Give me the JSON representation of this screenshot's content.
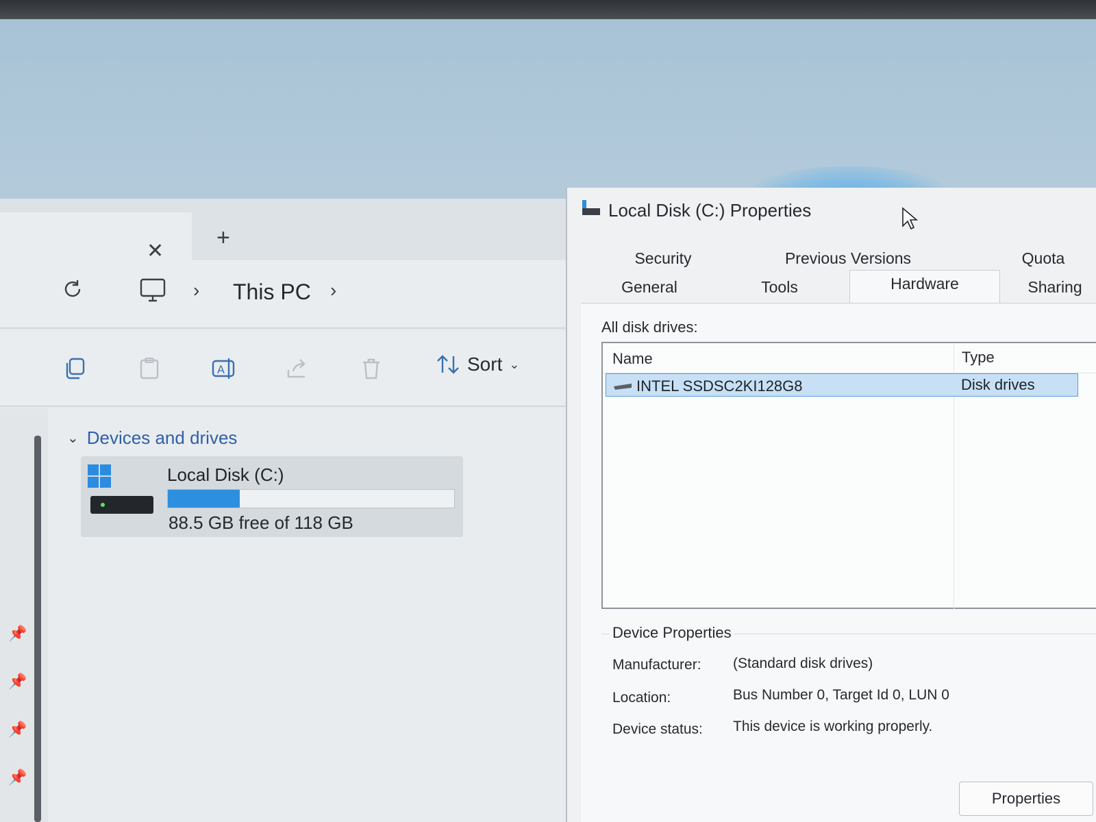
{
  "explorer": {
    "nav": {
      "crumb_this_pc": "This PC"
    },
    "toolbar": {
      "sort_label": "Sort"
    },
    "group": {
      "label": "Devices and drives"
    },
    "drive": {
      "name": "Local Disk (C:)",
      "free_text": "88.5 GB free of 118 GB",
      "used_fraction": 0.25
    }
  },
  "dialog": {
    "title": "Local Disk (C:) Properties",
    "tabs_row1": [
      "Security",
      "Previous Versions",
      "Quota"
    ],
    "tabs_row2": [
      "General",
      "Tools",
      "Hardware",
      "Sharing"
    ],
    "active_tab": "Hardware",
    "all_disk_label": "All disk drives:",
    "columns": {
      "name": "Name",
      "type": "Type"
    },
    "rows": [
      {
        "name": "INTEL SSDSC2KI128G8",
        "type": "Disk drives"
      }
    ],
    "device_properties": {
      "title": "Device Properties",
      "manufacturer_label": "Manufacturer:",
      "manufacturer_value": "(Standard disk drives)",
      "location_label": "Location:",
      "location_value": "Bus Number 0, Target Id 0, LUN 0",
      "status_label": "Device status:",
      "status_value": "This device is working properly."
    },
    "properties_button": "Properties"
  },
  "colors": {
    "accent": "#2e8fde",
    "selection": "#c7e0f6",
    "link": "#2f5fa8"
  }
}
